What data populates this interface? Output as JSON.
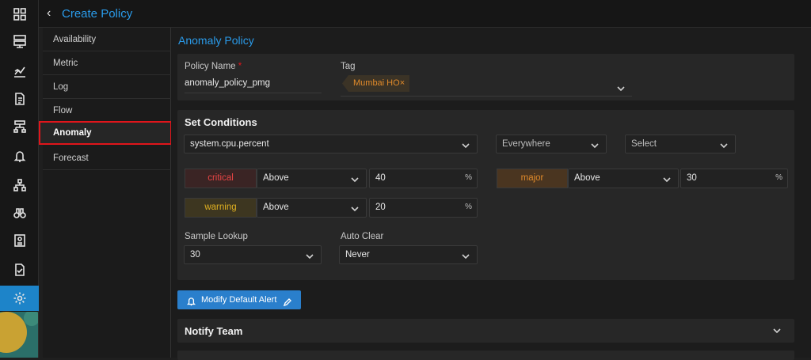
{
  "header": {
    "title": "Create Policy"
  },
  "subnav": {
    "items": [
      "Availability",
      "Metric",
      "Log",
      "Flow",
      "Anomaly",
      "Forecast"
    ]
  },
  "page": {
    "title": "Anomaly Policy"
  },
  "policy": {
    "name_label": "Policy Name",
    "name_value": "anomaly_policy_pmg",
    "tag_label": "Tag",
    "tag_value": "Mumbai HO",
    "tag_remove": "×"
  },
  "conditions": {
    "title": "Set Conditions",
    "metric": "system.cpu.percent",
    "scope": "Everywhere",
    "select": "Select",
    "critical": {
      "label": "critical",
      "op": "Above",
      "value": "40",
      "unit": "%"
    },
    "major": {
      "label": "major",
      "op": "Above",
      "value": "30",
      "unit": "%"
    },
    "warning": {
      "label": "warning",
      "op": "Above",
      "value": "20",
      "unit": "%"
    },
    "sample_lookup_label": "Sample Lookup",
    "sample_lookup_value": "30",
    "auto_clear_label": "Auto Clear",
    "auto_clear_value": "Never"
  },
  "actions": {
    "modify_alert": "Modify Default Alert"
  },
  "notify": {
    "title": "Notify Team"
  },
  "colors": {
    "accent": "#2a9bea",
    "critical": "#e84545",
    "major": "#e08a2a",
    "warning": "#e0b020",
    "selected_outline": "#e0151b"
  }
}
